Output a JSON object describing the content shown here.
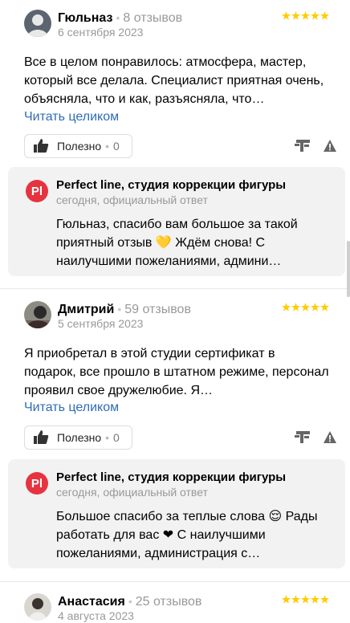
{
  "reviews": [
    {
      "name": "Гюльназ",
      "reviews_count": "8 отзывов",
      "date": "6 сентября 2023",
      "rating": 5,
      "text": "Все в целом понравилось: атмосфера, мастер, который все делала. Специалист приятная очень, объясняла, что и как, разъясняла, что…",
      "read_more": "Читать целиком",
      "useful_label": "Полезно",
      "useful_count": "0",
      "response": {
        "logo": "Pl",
        "org": "Perfect line, студия коррекции фигуры",
        "meta": "сегодня, официальный ответ",
        "text": "Гюльназ, спасибо вам большое за такой приятный отзыв 💛 Ждём снова! С наилучшими пожеланиями, админи…"
      }
    },
    {
      "name": "Дмитрий",
      "reviews_count": "59 отзывов",
      "date": "5 сентября 2023",
      "rating": 5,
      "text": "Я приобретал в этой студии сертификат в подарок, все прошло в штатном режиме, персонал проявил свое дружелюбие. Я…",
      "read_more": "Читать целиком",
      "useful_label": "Полезно",
      "useful_count": "0",
      "response": {
        "logo": "Pl",
        "org": "Perfect line, студия коррекции фигуры",
        "meta": "сегодня, официальный ответ",
        "text": "Большое спасибо за теплые слова 😌 Рады работать для вас ❤ С наилучшими пожеланиями, администрация с…"
      }
    },
    {
      "name": "Анастасия",
      "reviews_count": "25 отзывов",
      "date": "4 августа 2023",
      "rating": 5
    }
  ],
  "icons": {
    "star_color": "#fc0",
    "accent": "#2f6db5",
    "logo_bg": "#e5343f"
  }
}
